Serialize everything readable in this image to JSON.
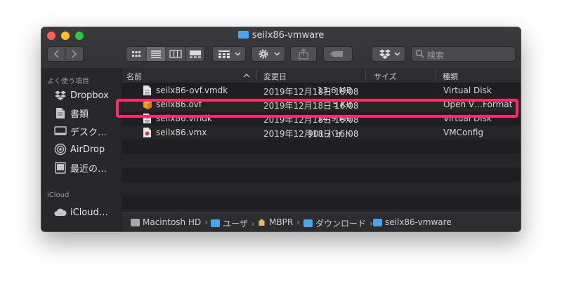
{
  "window": {
    "title": "seilx86-vmware"
  },
  "toolbar": {
    "search_placeholder": "検索"
  },
  "sidebar": {
    "favorites_header": "よく使う項目",
    "items": [
      {
        "label": "Dropbox",
        "icon": "dropbox-icon"
      },
      {
        "label": "書類",
        "icon": "document-icon"
      },
      {
        "label": "デスク…",
        "icon": "desktop-icon"
      },
      {
        "label": "AirDrop",
        "icon": "airdrop-icon"
      },
      {
        "label": "最近の…",
        "icon": "recents-icon"
      }
    ],
    "icloud_header": "iCloud",
    "icloud_items": [
      {
        "label": "iCloud…",
        "icon": "cloud-icon"
      }
    ]
  },
  "columns": {
    "name": "名前",
    "date": "変更日",
    "size": "サイズ",
    "kind": "種類"
  },
  "files": [
    {
      "name": "seilx86-ovf.vmdk",
      "date": "2019年12月18日 16:08",
      "size": "13.6 MB",
      "kind": "Virtual Disk",
      "icon": "vmdk-file-icon"
    },
    {
      "name": "seilx86.ovf",
      "date": "2019年12月18日 16:08",
      "size": "5 KB",
      "kind": "Open V…Format",
      "icon": "ovf-package-icon"
    },
    {
      "name": "seilx86.vmdk",
      "date": "2019年12月18日 16:08",
      "size": "14.9 MB",
      "kind": "Virtual Disk",
      "icon": "vmdk-file-icon"
    },
    {
      "name": "seilx86.vmx",
      "date": "2019年12月18日 16:08",
      "size": "901 バイト",
      "kind": "VMConfig",
      "icon": "vmx-file-icon"
    }
  ],
  "pathbar": [
    {
      "label": "Macintosh HD",
      "icon": "hard-disk-icon"
    },
    {
      "label": "ユーザ",
      "icon": "folder-icon"
    },
    {
      "label": "MBPR",
      "icon": "home-icon"
    },
    {
      "label": "ダウンロード",
      "icon": "downloads-folder-icon"
    },
    {
      "label": "seilx86-vmware",
      "icon": "folder-icon"
    }
  ],
  "colors": {
    "highlight": "#ff2a6a",
    "folder": "#4aa6e8"
  }
}
